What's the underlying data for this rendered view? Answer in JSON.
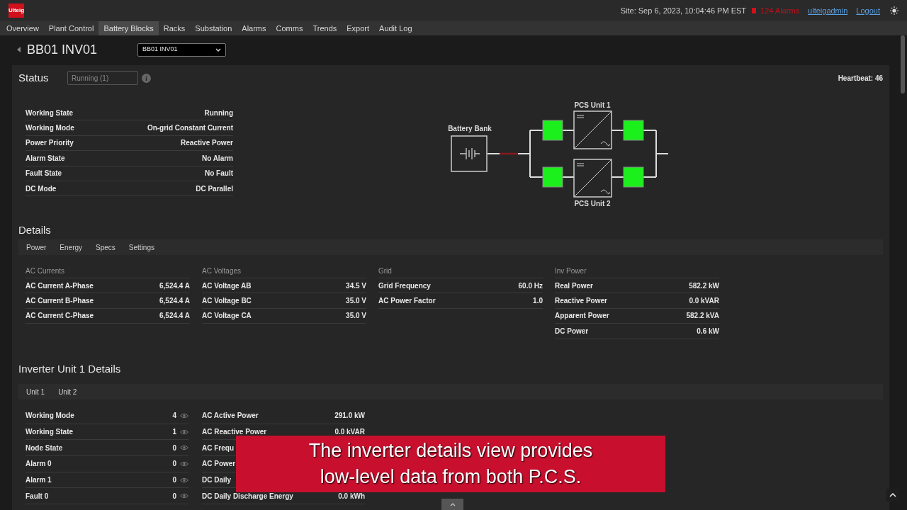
{
  "header": {
    "logo": "Ulteig",
    "site_time": "Site: Sep 6, 2023, 10:04:46 PM EST",
    "alarms": "124 Alarms",
    "user": "ulteigadmin",
    "logout": "Logout"
  },
  "nav": [
    {
      "label": "Overview",
      "selected": false
    },
    {
      "label": "Plant Control",
      "selected": false
    },
    {
      "label": "Battery Blocks",
      "selected": true
    },
    {
      "label": "Racks",
      "selected": false
    },
    {
      "label": "Substation",
      "selected": false
    },
    {
      "label": "Alarms",
      "selected": false
    },
    {
      "label": "Comms",
      "selected": false
    },
    {
      "label": "Trends",
      "selected": false
    },
    {
      "label": "Export",
      "selected": false
    },
    {
      "label": "Audit Log",
      "selected": false
    }
  ],
  "page_title": "BB01 INV01",
  "device_select": "BB01 INV01",
  "status": {
    "title": "Status",
    "field": "Running (1)",
    "heartbeat": "Heartbeat: 46",
    "rows": [
      {
        "label": "Working State",
        "value": "Running"
      },
      {
        "label": "Working Mode",
        "value": "On-grid Constant Current"
      },
      {
        "label": "Power Priority",
        "value": "Reactive Power"
      },
      {
        "label": "Alarm State",
        "value": "No Alarm"
      },
      {
        "label": "Fault State",
        "value": "No Fault"
      },
      {
        "label": "DC Mode",
        "value": "DC Parallel"
      }
    ]
  },
  "diagram": {
    "battery_label": "Battery Bank",
    "unit_1_label": "PCS Unit 1",
    "unit_2_label": "PCS Unit 2"
  },
  "details": {
    "title": "Details",
    "tabs": [
      "Power",
      "Energy",
      "Specs",
      "Settings"
    ],
    "groups": [
      {
        "title": "AC Currents",
        "rows": [
          {
            "label": "AC Current A-Phase",
            "value": "6,524.4 A"
          },
          {
            "label": "AC Current B-Phase",
            "value": "6,524.4 A"
          },
          {
            "label": "AC Current C-Phase",
            "value": "6,524.4 A"
          }
        ]
      },
      {
        "title": "AC Voltages",
        "rows": [
          {
            "label": "AC Voltage AB",
            "value": "34.5 V"
          },
          {
            "label": "AC Voltage BC",
            "value": "35.0 V"
          },
          {
            "label": "AC Voltage CA",
            "value": "35.0 V"
          }
        ]
      },
      {
        "title": "Grid",
        "rows": [
          {
            "label": "Grid Frequency",
            "value": "60.0 Hz"
          },
          {
            "label": "AC Power Factor",
            "value": "1.0"
          }
        ]
      },
      {
        "title": "Inv Power",
        "rows": [
          {
            "label": "Real Power",
            "value": "582.2 kW"
          },
          {
            "label": "Reactive Power",
            "value": "0.0 kVAR"
          },
          {
            "label": "Apparent Power",
            "value": "582.2 kVA"
          },
          {
            "label": "DC Power",
            "value": "0.6 kW"
          }
        ]
      }
    ]
  },
  "inverter": {
    "title": "Inverter Unit 1 Details",
    "tabs": [
      "Unit 1",
      "Unit 2"
    ],
    "left_rows": [
      {
        "label": "Working Mode",
        "value": "4"
      },
      {
        "label": "Working State",
        "value": "1"
      },
      {
        "label": "Node State",
        "value": "0"
      },
      {
        "label": "Alarm 0",
        "value": "0"
      },
      {
        "label": "Alarm 1",
        "value": "0"
      },
      {
        "label": "Fault 0",
        "value": "0"
      }
    ],
    "right_rows": [
      {
        "label": "AC Active Power",
        "value": "291.0 kW"
      },
      {
        "label": "AC Reactive Power",
        "value": "0.0 kVAR"
      },
      {
        "label": "AC Frequ"
      },
      {
        "label": "AC Power"
      },
      {
        "label": "DC Daily"
      },
      {
        "label": "DC Daily Discharge Energy",
        "value": "0.0 kWh"
      }
    ]
  },
  "caption": [
    "The inverter details view provides",
    "low-level data from both P.C.S."
  ]
}
